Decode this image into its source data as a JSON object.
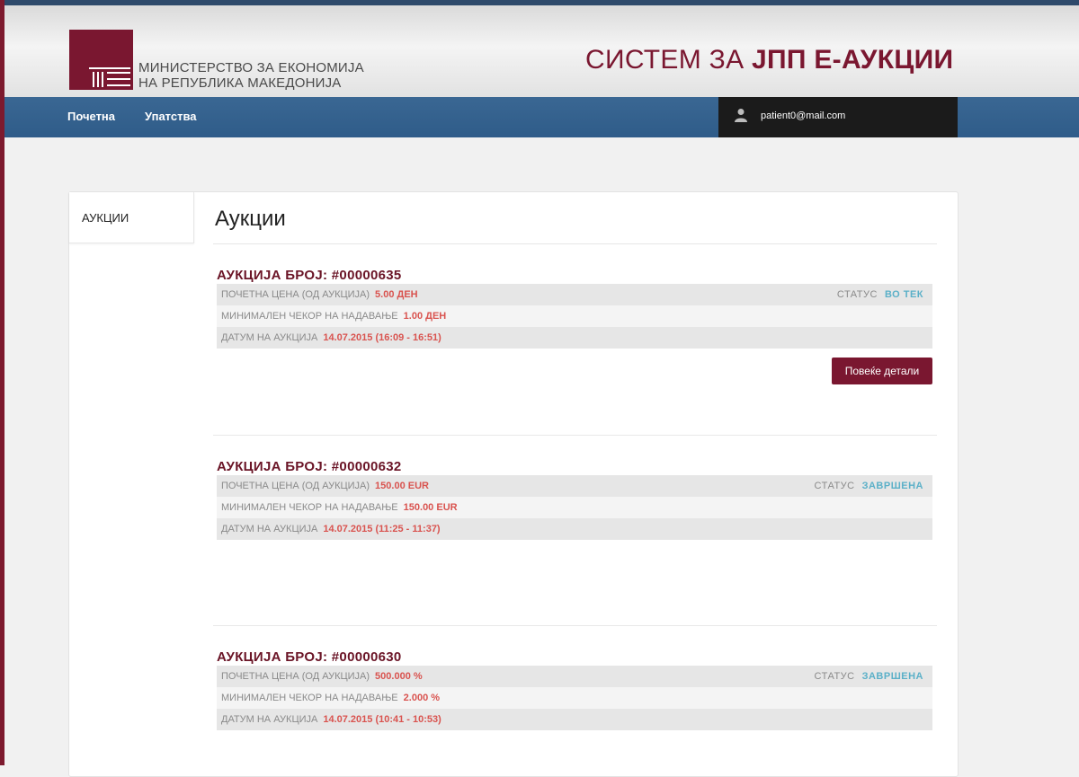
{
  "header": {
    "org_line1": "МИНИСТЕРСТВО ЗА ЕКОНОМИЈА",
    "org_line2": "НА РЕПУБЛИКА МАКЕДОНИЈА",
    "site_title_prefix": "СИСТЕМ ЗА ",
    "site_title_bold": "ЈПП Е-АУКЦИИ"
  },
  "nav": {
    "items": [
      {
        "label": "Почетна"
      },
      {
        "label": "Упатства"
      }
    ],
    "user_email": "patient0@mail.com"
  },
  "sidebar": {
    "items": [
      {
        "label": "АУКЦИИ"
      }
    ]
  },
  "main": {
    "title": "Аукции",
    "auctions": [
      {
        "title": "АУКЦИЈА БРОЈ: #00000635",
        "start_price_label": "ПОЧЕТНА ЦЕНА (ОД АУКЦИЈА)",
        "start_price": "5.00 ДЕН",
        "status_label": "СТАТУС",
        "status": "ВО ТЕК",
        "min_step_label": "МИНИМАЛЕН ЧЕКОР НА НАДАВАЊЕ",
        "min_step": "1.00 ДЕН",
        "date_label": "ДАТУМ НА АУКЦИЈА",
        "date": "14.07.2015 (16:09 - 16:51)",
        "button_label": "Повеќе детали"
      },
      {
        "title": "АУКЦИЈА БРОЈ: #00000632",
        "start_price_label": "ПОЧЕТНА ЦЕНА (ОД АУКЦИЈА)",
        "start_price": "150.00 EUR",
        "status_label": "СТАТУС",
        "status": "ЗАВРШЕНА",
        "min_step_label": "МИНИМАЛЕН ЧЕКОР НА НАДАВАЊЕ",
        "min_step": "150.00 EUR",
        "date_label": "ДАТУМ НА АУКЦИЈА",
        "date": "14.07.2015 (11:25 - 11:37)"
      },
      {
        "title": "АУКЦИЈА БРОЈ: #00000630",
        "start_price_label": "ПОЧЕТНА ЦЕНА (ОД АУКЦИЈА)",
        "start_price": "500.000 %",
        "status_label": "СТАТУС",
        "status": "ЗАВРШЕНА",
        "min_step_label": "МИНИМАЛЕН ЧЕКОР НА НАДАВАЊЕ",
        "min_step": "2.000 %",
        "date_label": "ДАТУМ НА АУКЦИЈА",
        "date": "14.07.2015 (10:41 - 10:53)"
      }
    ]
  },
  "colors": {
    "brand": "#7a1730",
    "nav": "#2f5c89",
    "value": "#d9534f",
    "status": "#5bb0c8"
  }
}
